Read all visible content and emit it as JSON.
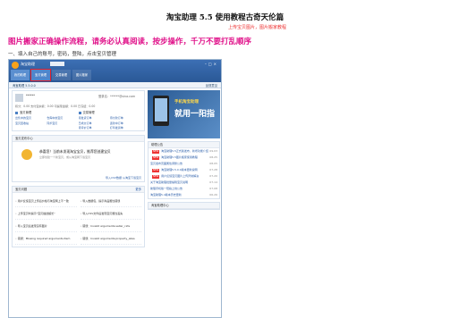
{
  "doc": {
    "title": "淘宝助理 5.5 使用教程古奇天伦篇",
    "subtitle": "上传宝贝图片，图片搬家教程",
    "warning": "图片搬家正确操作流程，请务必认真阅读，按步操作，千万不要打乱顺序",
    "step1": "一、填入自己的账号，密码，登陆，点击宝贝管理"
  },
  "screenshot": {
    "tabs": [
      {
        "label": "我的助理"
      },
      {
        "label": "宝贝管理"
      },
      {
        "label": "交易管理"
      },
      {
        "label": "图片搬家"
      }
    ],
    "breadcrumb": "淘宝助理 5.5.0.0",
    "subbar_right": "反馈意见",
    "email": "登录名：******@sina.com",
    "balance": "积分：0.00   支付宝余额：0.00   可提现金额：0.00   已冻结：0.00",
    "sec_left_title": "宝贝管理",
    "sec_left_links": [
      "出售中的宝贝",
      "仓库中的宝贝",
      "宝贝回收站",
      "同步宝贝"
    ],
    "sec_right_title": "交易管理",
    "sec_right_links": [
      "待发货订单",
      "待付款订单",
      "已成交订单",
      "退款中订单",
      "待评价订单",
      "打印发货单"
    ],
    "news_title": "宝贝发布中心",
    "news_main": "恭喜您！当前未发现淘宝宝贝，推荐您创建宝贝",
    "news_sub": "立即创建一个新宝贝，或从淘宝网下载宝贝",
    "news_links": "导入CSV数据   从淘宝下载宝贝",
    "wiki_title": "宝贝问题",
    "wiki_items": [
      "用户反馈宝贝上传后价格与淘宝网上不一致",
      "导入数据包，提示商品属性错误",
      "上传宝贝时提示\"宝贝描述超长\"",
      "导入CSV文件后发现宝贝属性丢失",
      "导入宝贝后发现没有图片",
      "错误：Invalid arguments:seller_cids",
      "错误：Missing required arguments:item",
      "错误：Invalid arguments:property_alias"
    ],
    "banner_line1": "手机淘宝助理",
    "banner_line2": "就用一阳指",
    "side_title": "助理公告",
    "side_items": [
      {
        "text": "淘宝助理5.5正式版发布，新增功能介绍",
        "date": "09-03"
      },
      {
        "text": "淘宝助理5.5图片搬家使用教程",
        "date": "08-25"
      },
      {
        "text": "宝贝发布页面属性调整公告",
        "date": "08-05"
      },
      {
        "text": "淘宝助理5.5.0.0版本更新说明",
        "date": "07-28"
      },
      {
        "text": "用户反馈宝贝图片上传异常解决",
        "date": "07-20"
      },
      {
        "text": "关于淘宝助理批量编辑宝贝说明",
        "date": "07-14"
      },
      {
        "text": "助理手机版一阳指上线公告",
        "date": "07-08"
      },
      {
        "text": "淘宝助理5.4版本历史更新",
        "date": "06-26"
      }
    ],
    "side_title2": "淘宝助理中心"
  }
}
